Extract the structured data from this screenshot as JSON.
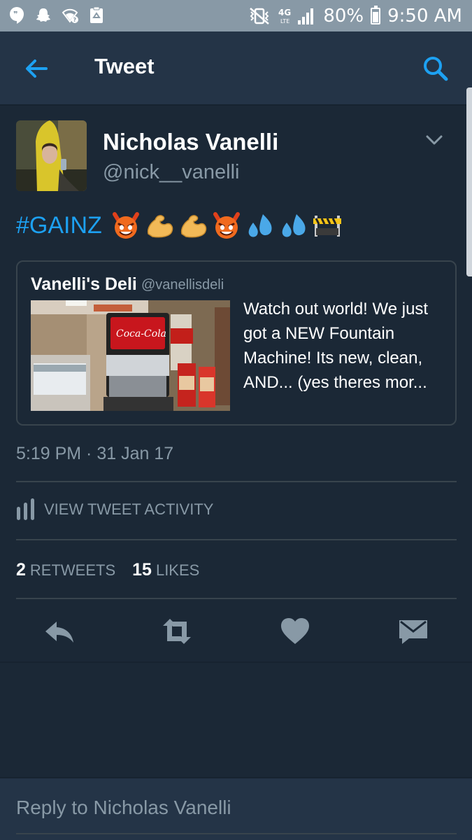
{
  "status_bar": {
    "battery": "80%",
    "time": "9:50 AM",
    "network": "4G LTE"
  },
  "header": {
    "title": "Tweet"
  },
  "tweet": {
    "author_name": "Nicholas Vanelli",
    "author_handle": "@nick__vanelli",
    "hashtag": "#GAINZ",
    "emojis": [
      "smiling-imp-emoji",
      "flexed-biceps-emoji",
      "flexed-biceps-emoji",
      "smiling-imp-emoji",
      "sweat-droplets-emoji",
      "sweat-droplets-emoji",
      "construction-barrier-emoji"
    ],
    "timestamp": "5:19 PM · 31 Jan 17"
  },
  "quoted_tweet": {
    "name": "Vanelli's Deli",
    "handle": "@vanellisdeli",
    "text": "Watch out world! We just got a NEW Fountain Machine! Its new, clean, AND... (yes theres mor..."
  },
  "activity": {
    "label": "VIEW TWEET ACTIVITY"
  },
  "stats": {
    "retweets_count": "2",
    "retweets_label": "RETWEETS",
    "likes_count": "15",
    "likes_label": "LIKES"
  },
  "reply": {
    "placeholder": "Reply to Nicholas Vanelli"
  },
  "colors": {
    "background": "#1b2836",
    "header": "#243447",
    "accent": "#1da1f2",
    "secondary_text": "#8899a6"
  }
}
